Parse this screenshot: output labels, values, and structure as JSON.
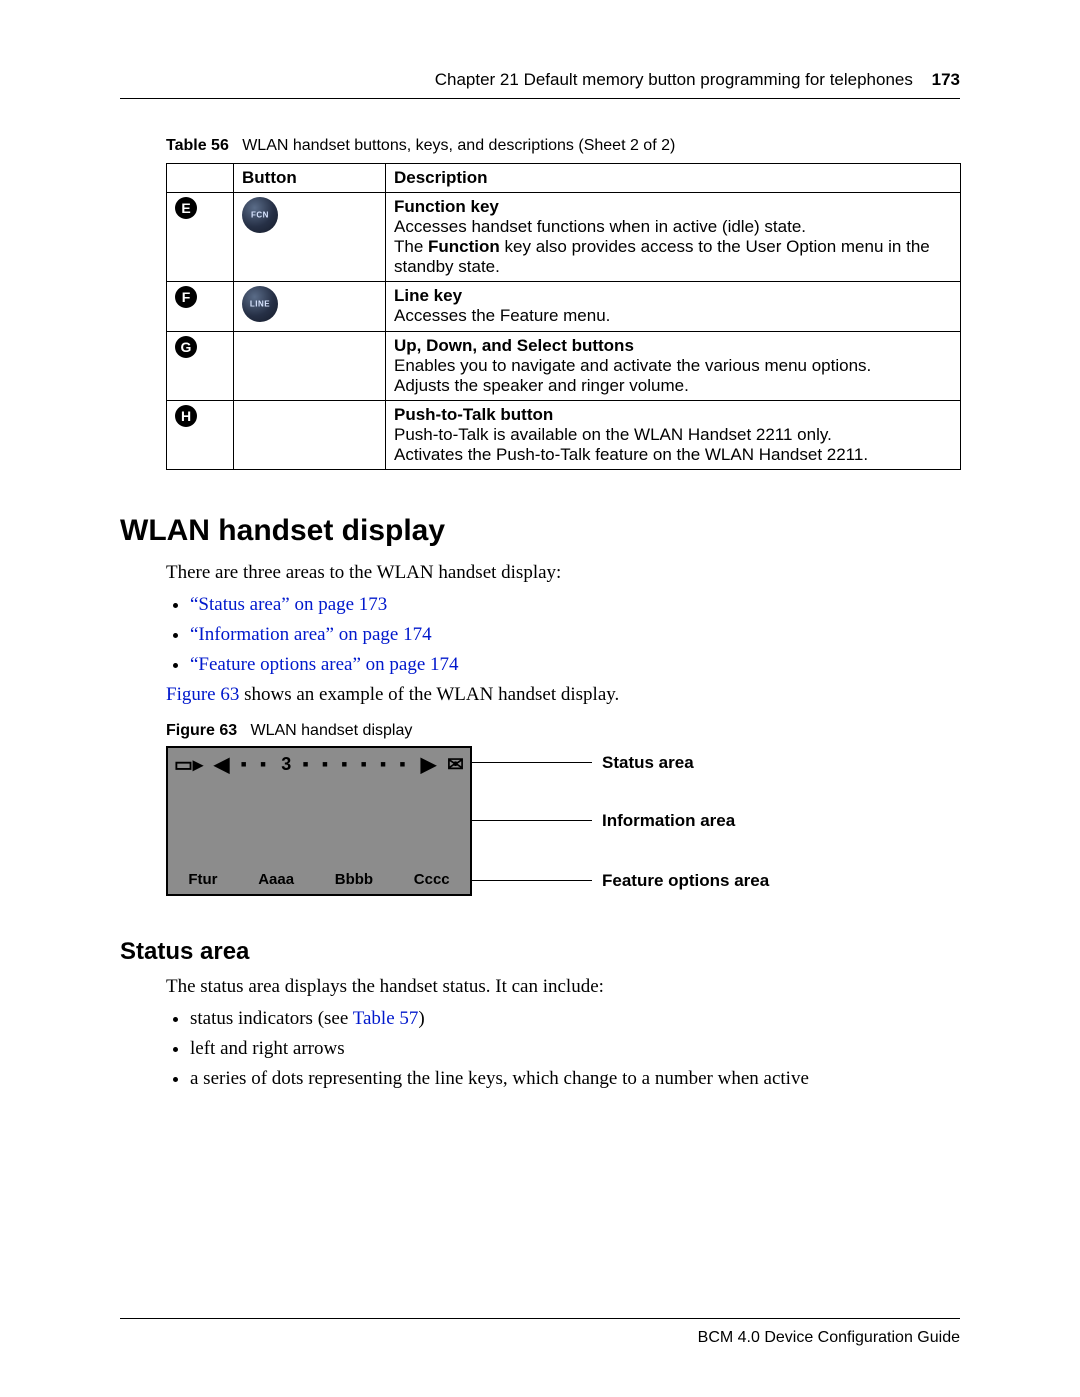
{
  "header": {
    "chapter": "Chapter 21  Default memory button programming for telephones",
    "page_num": "173"
  },
  "table": {
    "caption_label": "Table 56",
    "caption_text": "WLAN handset buttons, keys, and descriptions (Sheet 2 of 2)",
    "head_button": "Button",
    "head_desc": "Description",
    "rows": [
      {
        "marker": "E",
        "key_label": "FCN",
        "title": "Function key",
        "body1": "Accesses handset functions when in active (idle) state.",
        "body2_pre": "The ",
        "body2_bold": "Function",
        "body2_post": " key also provides access to the User Option menu in the standby state."
      },
      {
        "marker": "F",
        "key_label": "LINE",
        "title": "Line key",
        "body1": "Accesses the Feature menu.",
        "body2_pre": "",
        "body2_bold": "",
        "body2_post": ""
      },
      {
        "marker": "G",
        "key_label": "",
        "title": "Up, Down, and Select buttons",
        "body1": "Enables you to navigate and activate the various menu options.",
        "body2_pre": "Adjusts the speaker and ringer volume.",
        "body2_bold": "",
        "body2_post": ""
      },
      {
        "marker": "H",
        "key_label": "",
        "title": "Push-to-Talk button",
        "body1": "Push-to-Talk is available on the WLAN Handset 2211 only.",
        "body2_pre": "Activates the Push-to-Talk feature on the WLAN Handset 2211.",
        "body2_bold": "",
        "body2_post": ""
      }
    ]
  },
  "section1": {
    "title": "WLAN handset display",
    "intro": "There are three areas to the WLAN handset display:",
    "links": [
      "“Status area” on page 173",
      "“Information area” on page 174",
      "“Feature options area” on page 174"
    ],
    "after_link_ref": "Figure 63",
    "after_link_text": " shows an example of the WLAN handset display."
  },
  "figure": {
    "caption_label": "Figure 63",
    "caption_text": "WLAN handset display",
    "status_digit": "3",
    "feat_options": [
      "Ftur",
      "Aaaa",
      "Bbbb",
      "Cccc"
    ],
    "labels": {
      "status": "Status area",
      "info": "Information area",
      "feat": "Feature options area"
    }
  },
  "section2": {
    "title": "Status area",
    "intro": "The status area displays the handset status. It can include:",
    "items_pre1": "status indicators (see ",
    "items_ref1": "Table 57",
    "items_post1": ")",
    "items2": "left and right arrows",
    "items3": "a series of dots representing the line keys, which change to a number when active"
  },
  "footer": {
    "text": "BCM 4.0 Device Configuration Guide"
  }
}
